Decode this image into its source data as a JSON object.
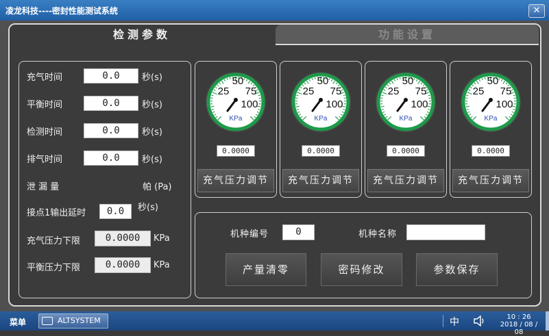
{
  "window": {
    "title": "凌龙科技----密封性能测试系统",
    "close_label": "✕"
  },
  "tabs": [
    {
      "label": "检测参数"
    },
    {
      "label": "功能设置"
    }
  ],
  "params": {
    "charge_time": {
      "label": "充气时间",
      "value": "0.0",
      "unit": "秒(s)"
    },
    "balance_time": {
      "label": "平衡时间",
      "value": "0.0",
      "unit": "秒(s)"
    },
    "detect_time": {
      "label": "检测时间",
      "value": "0.0",
      "unit": "秒(s)"
    },
    "exhaust_time": {
      "label": "排气时间",
      "value": "0.0",
      "unit": "秒(s)"
    },
    "leak": {
      "label": "泄 漏 量",
      "unit": "帕 (Pa)"
    },
    "contact_delay": {
      "label": "接点1输出延时",
      "value": "0.0",
      "unit": "秒(s)"
    },
    "charge_low": {
      "label": "充气压力下限",
      "value": "0.0000",
      "unit": "KPa"
    },
    "balance_low": {
      "label": "平衡压力下限",
      "value": "0.0000",
      "unit": "KPa"
    }
  },
  "gauges": [
    {
      "value_text": "0.0000",
      "button": "充气压力调节"
    },
    {
      "value_text": "0.0000",
      "button": "充气压力调节"
    },
    {
      "value_text": "0.0000",
      "button": "充气压力调节"
    },
    {
      "value_text": "0.0000",
      "button": "充气压力调节"
    }
  ],
  "gauge_scale": {
    "labels": [
      "25",
      "50",
      "75",
      "100"
    ],
    "unit": "KPa"
  },
  "machine": {
    "id_label": "机种编号",
    "id_value": "0",
    "name_label": "机种名称",
    "name_value": ""
  },
  "actions": {
    "reset": "产量清零",
    "password": "密码修改",
    "save": "参数保存"
  },
  "taskbar": {
    "start": "菜单",
    "app": "ALTSYSTEM",
    "ime": "中",
    "time": "10 : 26",
    "date": "2018 / 08 / 08"
  },
  "colors": {
    "gauge_ring": "#1e9a4a",
    "titlebar": "#2a6bb3"
  }
}
